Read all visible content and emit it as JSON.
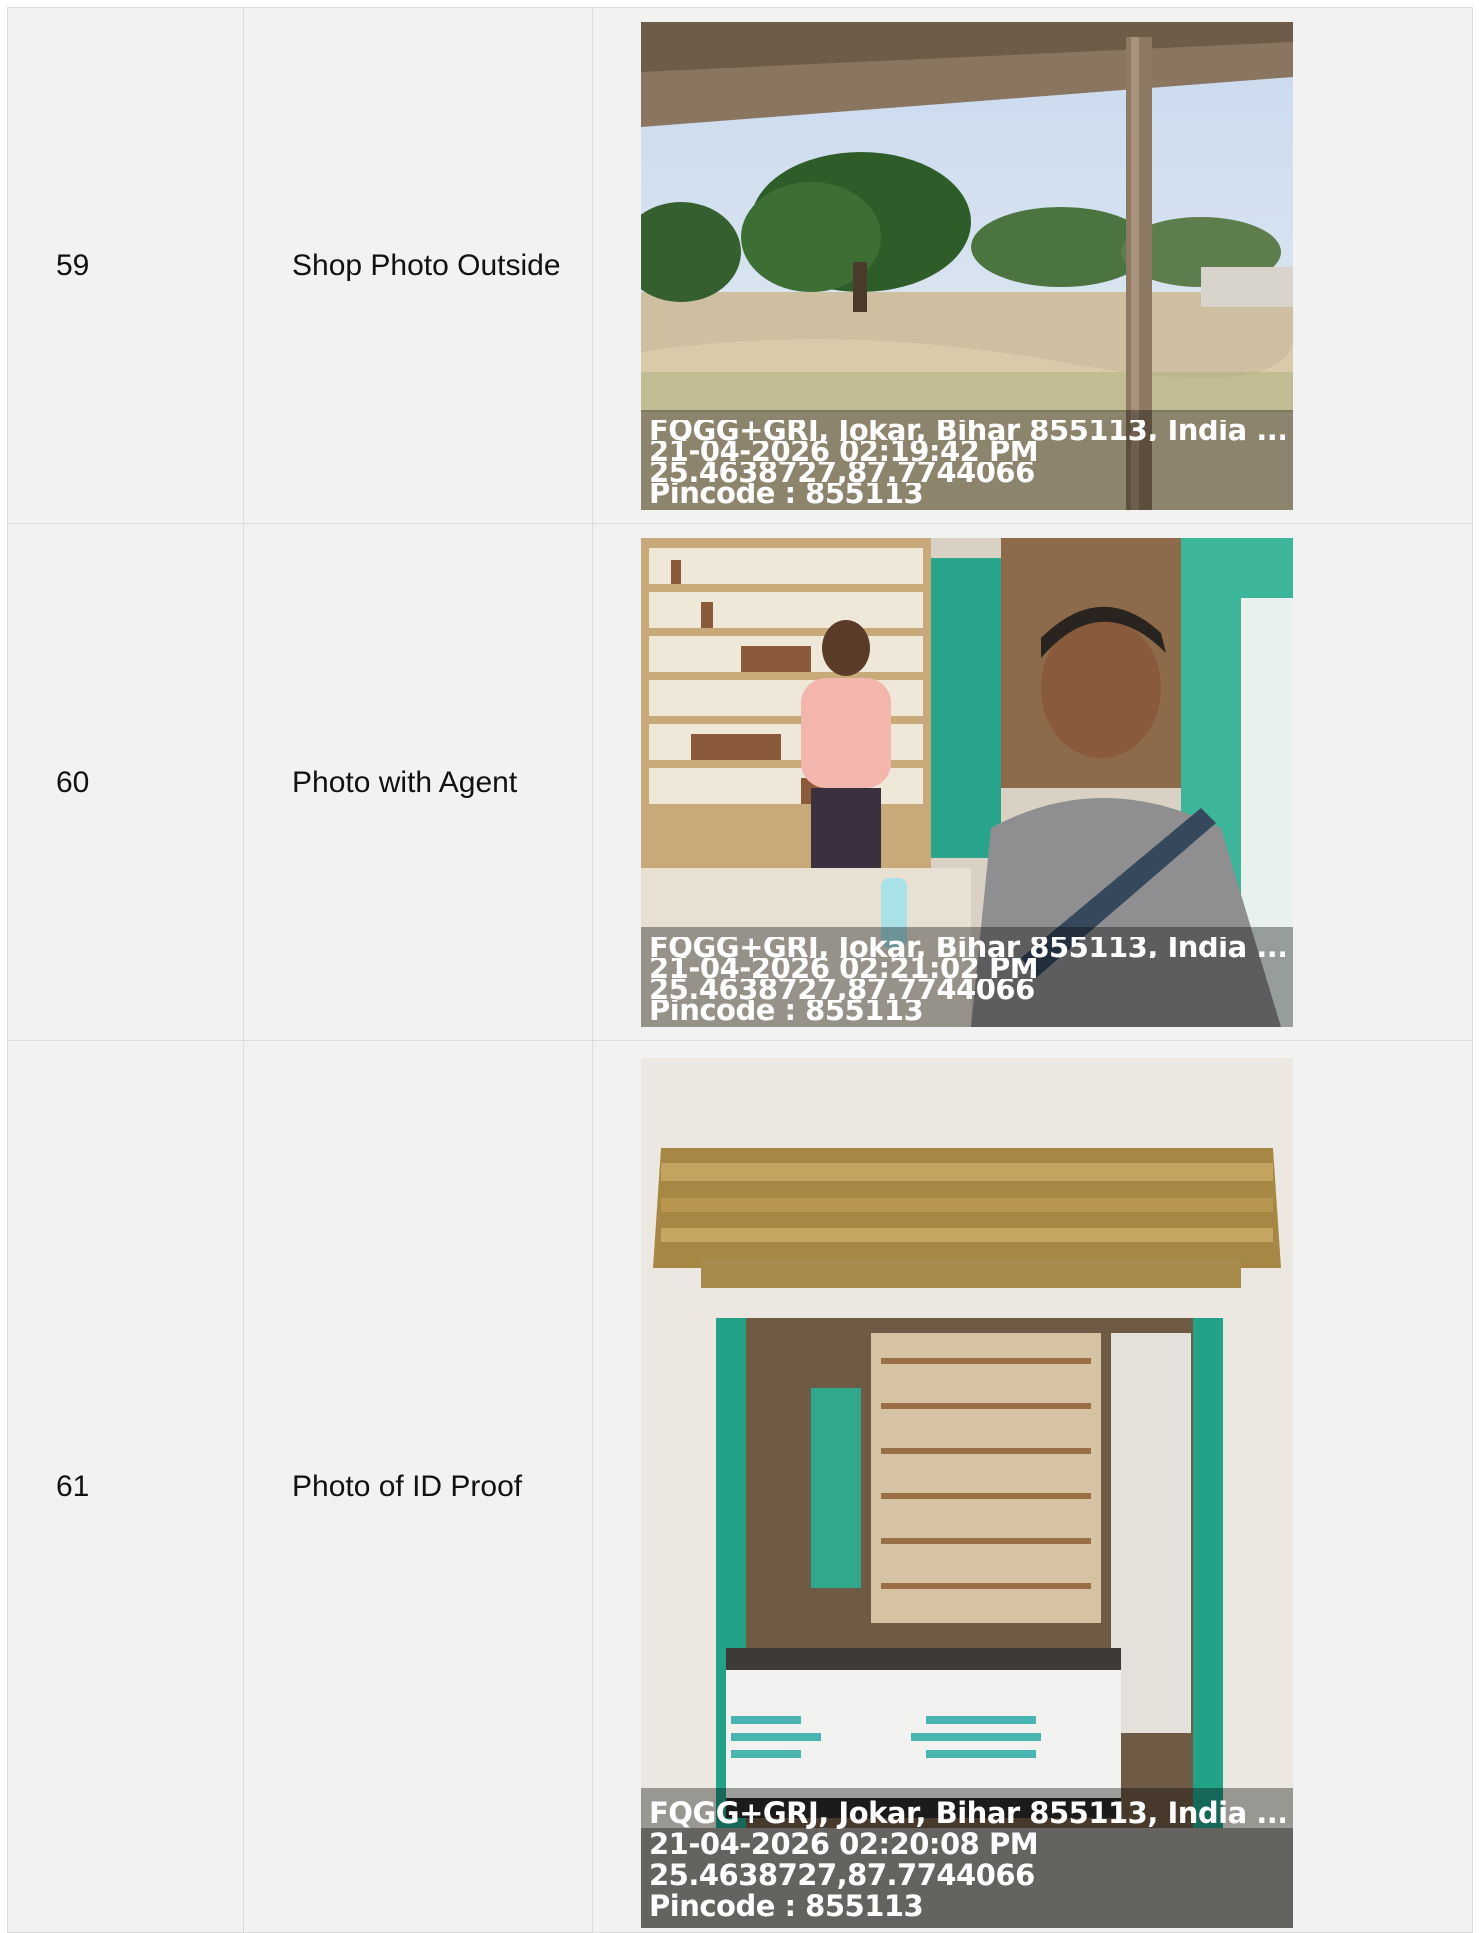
{
  "rows": [
    {
      "number": "59",
      "label": "Shop Photo Outside",
      "photo_description_icon": "outdoor-field-photo",
      "stamp": {
        "address": "FQGG+GRJ, Jokar, Bihar 855113, India ...",
        "datetime": "21-04-2026 02:19:42 PM",
        "coords": "25.4638727,87.7744066",
        "pincode": "Pincode : 855113"
      }
    },
    {
      "number": "60",
      "label": "Photo with Agent",
      "photo_description_icon": "selfie-in-shop-photo",
      "stamp": {
        "address": "FQGG+GRJ, Jokar, Bihar 855113, India ...",
        "datetime": "21-04-2026 02:21:02 PM",
        "coords": "25.4638727,87.7744066",
        "pincode": "Pincode : 855113"
      }
    },
    {
      "number": "61",
      "label": "Photo of ID Proof",
      "photo_description_icon": "shop-front-photo",
      "stamp": {
        "address": "FQGG+GRJ, Jokar, Bihar 855113, India ...",
        "datetime": "21-04-2026 02:20:08 PM",
        "coords": "25.4638727,87.7744066",
        "pincode": "Pincode : 855113"
      }
    }
  ]
}
